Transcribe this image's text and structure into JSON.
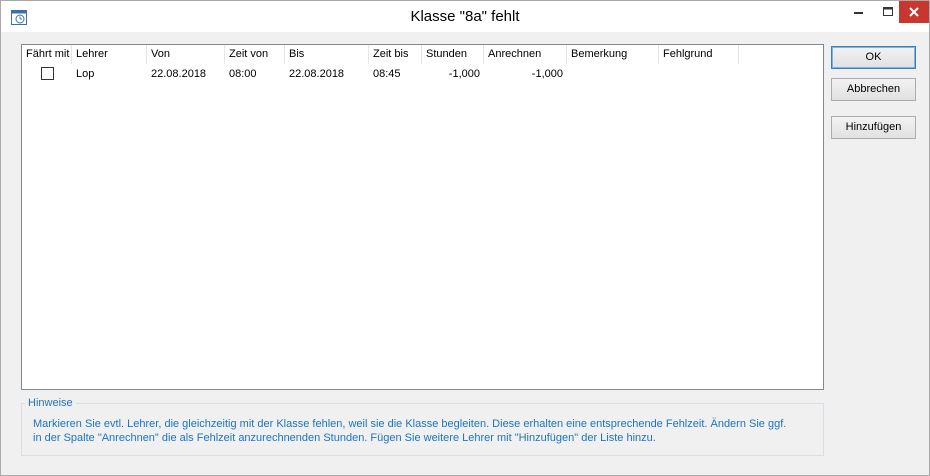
{
  "window": {
    "title": "Klasse \"8a\" fehlt"
  },
  "table": {
    "columns": [
      "Fährt mit",
      "Lehrer",
      "Von",
      "Zeit von",
      "Bis",
      "Zeit bis",
      "Stunden",
      "Anrechnen",
      "Bemerkung",
      "Fehlgrund"
    ],
    "rows": [
      {
        "faehrt_mit": false,
        "lehrer": "Lop",
        "von": "22.08.2018",
        "zeit_von": "08:00",
        "bis": "22.08.2018",
        "zeit_bis": "08:45",
        "stunden": "-1,000",
        "anrechnen": "-1,000",
        "bemerkung": "",
        "fehlgrund": ""
      }
    ]
  },
  "buttons": {
    "ok": "OK",
    "cancel": "Abbrechen",
    "add": "Hinzufügen"
  },
  "hints": {
    "title": "Hinweise",
    "text": "Markieren Sie evtl. Lehrer, die gleichzeitig mit der Klasse fehlen, weil sie die Klasse begleiten. Diese erhalten eine entsprechende Fehlzeit. Ändern Sie ggf. in der Spalte \"Anrechnen\" die als Fehlzeit anzurechnenden Stunden. Fügen Sie weitere Lehrer mit \"Hinzufügen\" der Liste hinzu."
  },
  "colors": {
    "hint_text": "#1c74bf",
    "close_button": "#c7372f"
  },
  "icons": {
    "app": "clock-window-icon",
    "minimize": "minimize-icon",
    "maximize": "maximize-icon",
    "close": "close-icon"
  }
}
